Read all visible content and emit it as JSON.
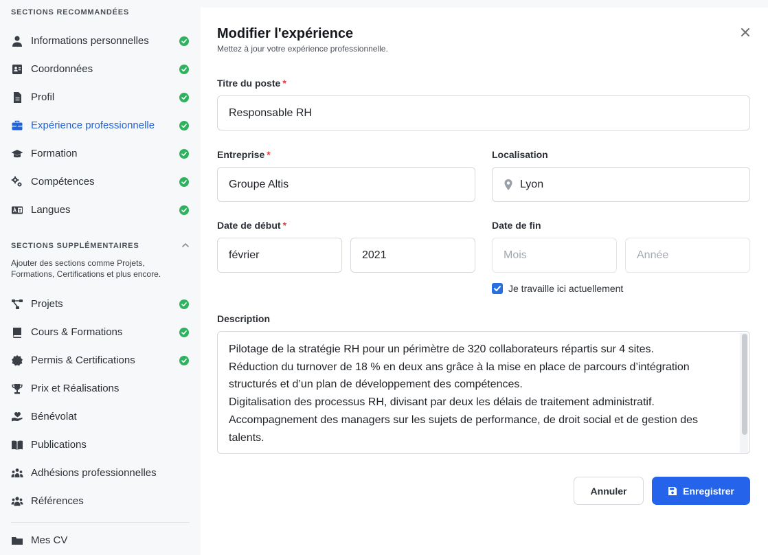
{
  "sidebar": {
    "recommended_title": "SECTIONS RECOMMANDÉES",
    "recommended": [
      {
        "label": "Informations personnelles",
        "icon": "user-icon",
        "done": true
      },
      {
        "label": "Coordonnées",
        "icon": "address-card-icon",
        "done": true
      },
      {
        "label": "Profil",
        "icon": "document-icon",
        "done": true
      },
      {
        "label": "Expérience professionnelle",
        "icon": "briefcase-icon",
        "done": true,
        "active": true
      },
      {
        "label": "Formation",
        "icon": "graduation-cap-icon",
        "done": true
      },
      {
        "label": "Compétences",
        "icon": "gears-icon",
        "done": true
      },
      {
        "label": "Langues",
        "icon": "language-icon",
        "done": true
      }
    ],
    "supplementary_title": "SECTIONS SUPPLÉMENTAIRES",
    "supplementary_desc": "Ajouter des sections comme Projets, Formations, Certifications et plus encore.",
    "supplementary": [
      {
        "label": "Projets",
        "icon": "project-diagram-icon",
        "done": true
      },
      {
        "label": "Cours & Formations",
        "icon": "book-icon",
        "done": true
      },
      {
        "label": "Permis & Certifications",
        "icon": "certificate-icon",
        "done": true
      },
      {
        "label": "Prix et Réalisations",
        "icon": "trophy-icon",
        "done": false
      },
      {
        "label": "Bénévolat",
        "icon": "hand-heart-icon",
        "done": false
      },
      {
        "label": "Publications",
        "icon": "open-book-icon",
        "done": false
      },
      {
        "label": "Adhésions professionnelles",
        "icon": "people-group-icon",
        "done": false
      },
      {
        "label": "Références",
        "icon": "users-icon",
        "done": false
      }
    ],
    "bottom": {
      "label": "Mes CV",
      "icon": "folder-icon"
    }
  },
  "form": {
    "title": "Modifier l'expérience",
    "subtitle": "Mettez à jour votre expérience professionnelle.",
    "job_title_label": "Titre du poste",
    "job_title_value": "Responsable RH",
    "company_label": "Entreprise",
    "company_value": "Groupe Altis",
    "location_label": "Localisation",
    "location_value": "Lyon",
    "start_label": "Date de début",
    "start_month": "février",
    "start_year": "2021",
    "end_label": "Date de fin",
    "end_month_placeholder": "Mois",
    "end_year_placeholder": "Année",
    "current_label": "Je travaille ici actuellement",
    "current_checked": true,
    "description_label": "Description",
    "description_lines": [
      "Pilotage de la stratégie RH pour un périmètre de 320 collaborateurs répartis sur 4 sites.",
      "Réduction du turnover de 18 % en deux ans grâce à la mise en place de parcours d’intégration",
      "structurés et d’un plan de développement des compétences.",
      "Digitalisation des processus RH, divisant par deux les délais de traitement administratif.",
      "Accompagnement des managers sur les sujets de performance, de droit social et de gestion des",
      "talents."
    ],
    "required_marker": "*",
    "cancel_label": "Annuler",
    "save_label": "Enregistrer"
  },
  "colors": {
    "accent": "#2563eb",
    "success": "#2fb25f",
    "required": "#e03a3a"
  }
}
